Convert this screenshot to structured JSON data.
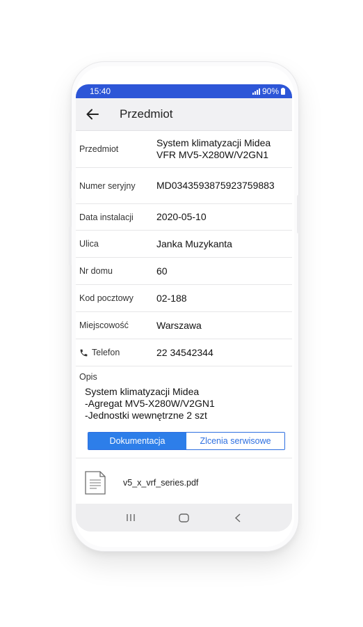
{
  "status_bar": {
    "time": "15:40",
    "battery": "90%"
  },
  "app_bar": {
    "title": "Przedmiot"
  },
  "fields": [
    {
      "label": "Przedmiot",
      "value": "System klimatyzacji Midea\nVFR MV5-X280W/V2GN1"
    },
    {
      "label": "Numer seryjny",
      "value": "MD0343593875923759883"
    },
    {
      "label": "Data instalacji",
      "value": "2020-05-10"
    },
    {
      "label": "Ulica",
      "value": "Janka Muzykanta"
    },
    {
      "label": "Nr domu",
      "value": "60"
    },
    {
      "label": "Kod pocztowy",
      "value": "02-188"
    },
    {
      "label": "Miejscowość",
      "value": "Warszawa"
    },
    {
      "label": "Telefon",
      "value": "22 34542344"
    }
  ],
  "description": {
    "label": "Opis",
    "text": "System klimatyzacji Midea\n-Agregat MV5-X280W/V2GN1\n-Jednostki wewnętrzne 2 szt"
  },
  "tabs": [
    {
      "label": "Dokumentacja",
      "active": true
    },
    {
      "label": "Zlcenia serwisowe",
      "active": false
    }
  ],
  "documents": [
    {
      "name": "v5_x_vrf_series.pdf"
    }
  ],
  "colors": {
    "accent": "#2d56d7",
    "tab_active": "#2d7ee9"
  }
}
